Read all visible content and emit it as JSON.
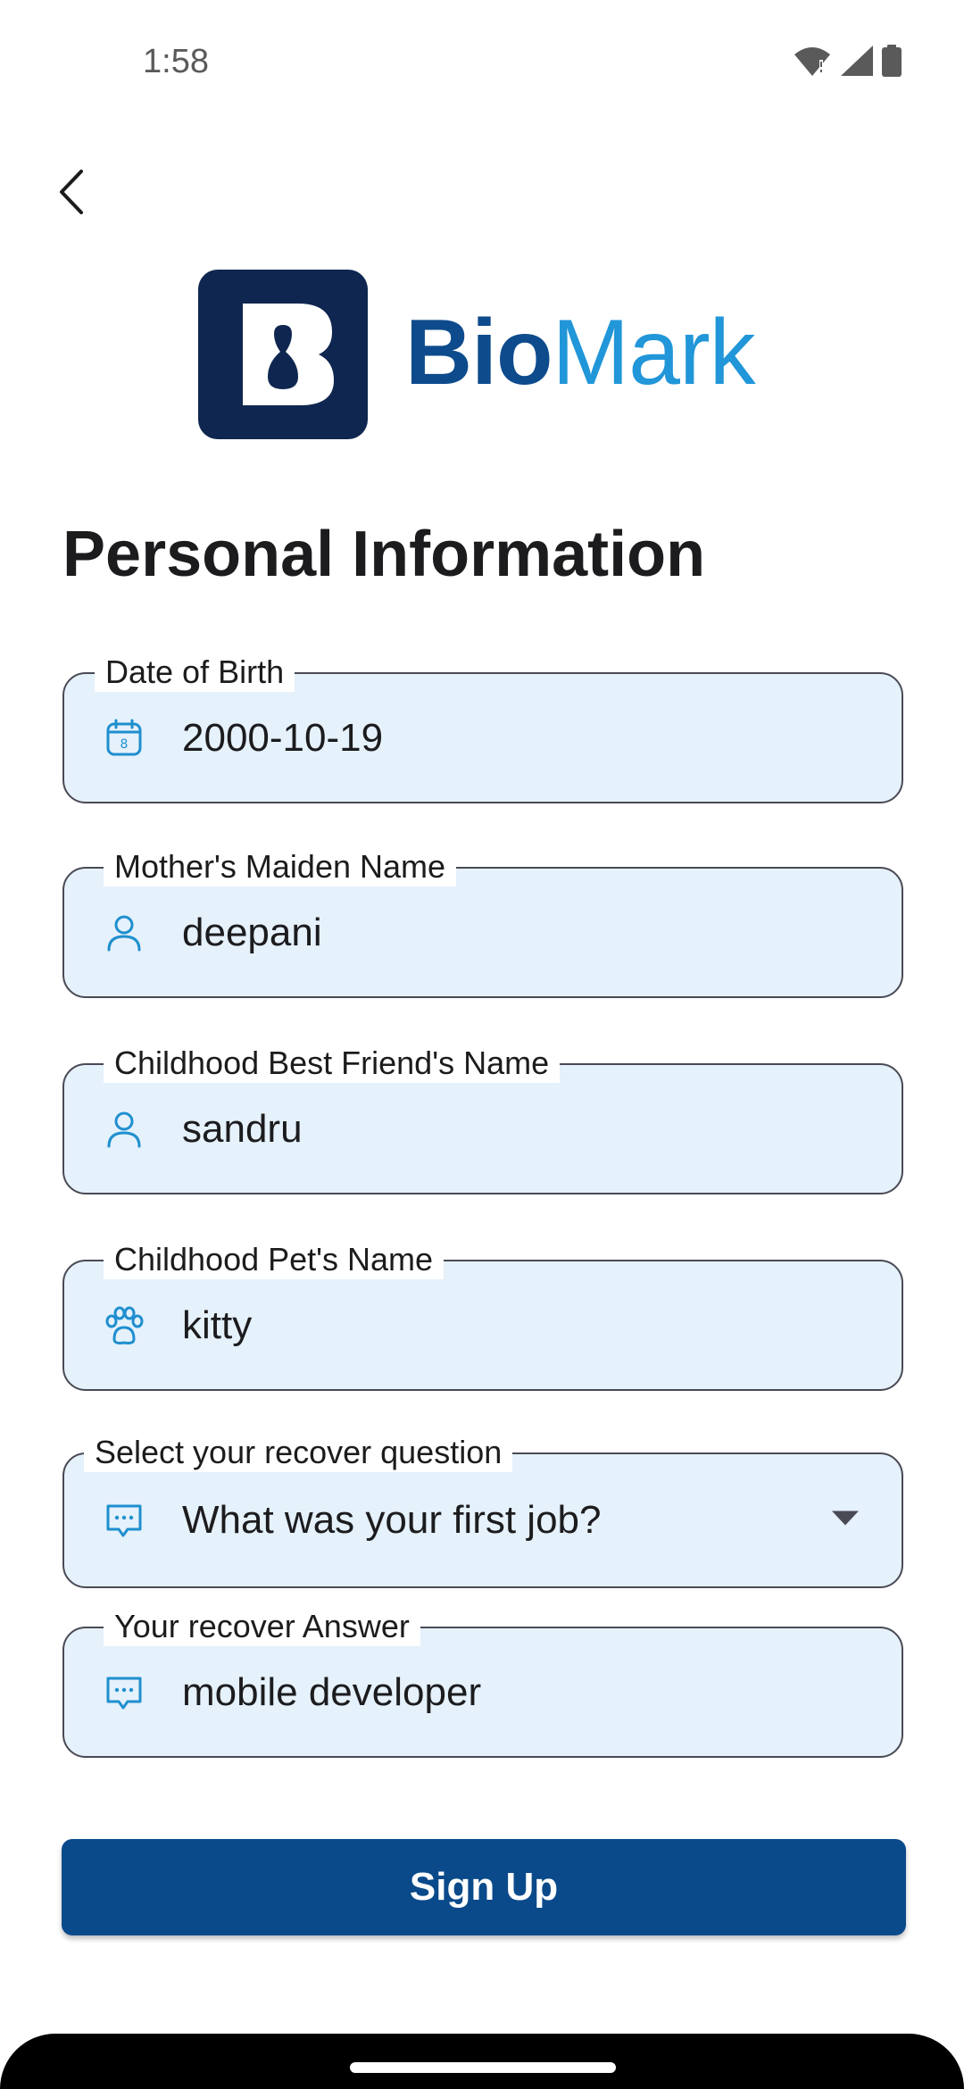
{
  "status_bar": {
    "time": "1:58",
    "icons": [
      "wifi-icon",
      "signal-icon",
      "battery-icon"
    ]
  },
  "brand": {
    "name_bold": "Bio",
    "name_light": "Mark",
    "colors": {
      "dark": "#0f2750",
      "bold": "#0d4b8c",
      "light": "#2196d8"
    }
  },
  "page": {
    "title": "Personal Information"
  },
  "form": {
    "fields": [
      {
        "label": "Date of Birth",
        "value": "2000-10-19",
        "icon": "calendar-icon"
      },
      {
        "label": "Mother's Maiden Name",
        "value": "deepani",
        "icon": "person-icon"
      },
      {
        "label": "Childhood Best Friend's Name",
        "value": "sandru",
        "icon": "person-icon"
      },
      {
        "label": "Childhood Pet's Name",
        "value": "kitty",
        "icon": "paw-icon"
      },
      {
        "label": "Select your recover question",
        "value": "What was your first job?",
        "icon": "chat-icon"
      },
      {
        "label": "Your recover Answer",
        "value": "mobile developer",
        "icon": "chat-icon"
      }
    ]
  },
  "actions": {
    "signup_label": "Sign Up",
    "button_color": "#0a4a8a"
  }
}
